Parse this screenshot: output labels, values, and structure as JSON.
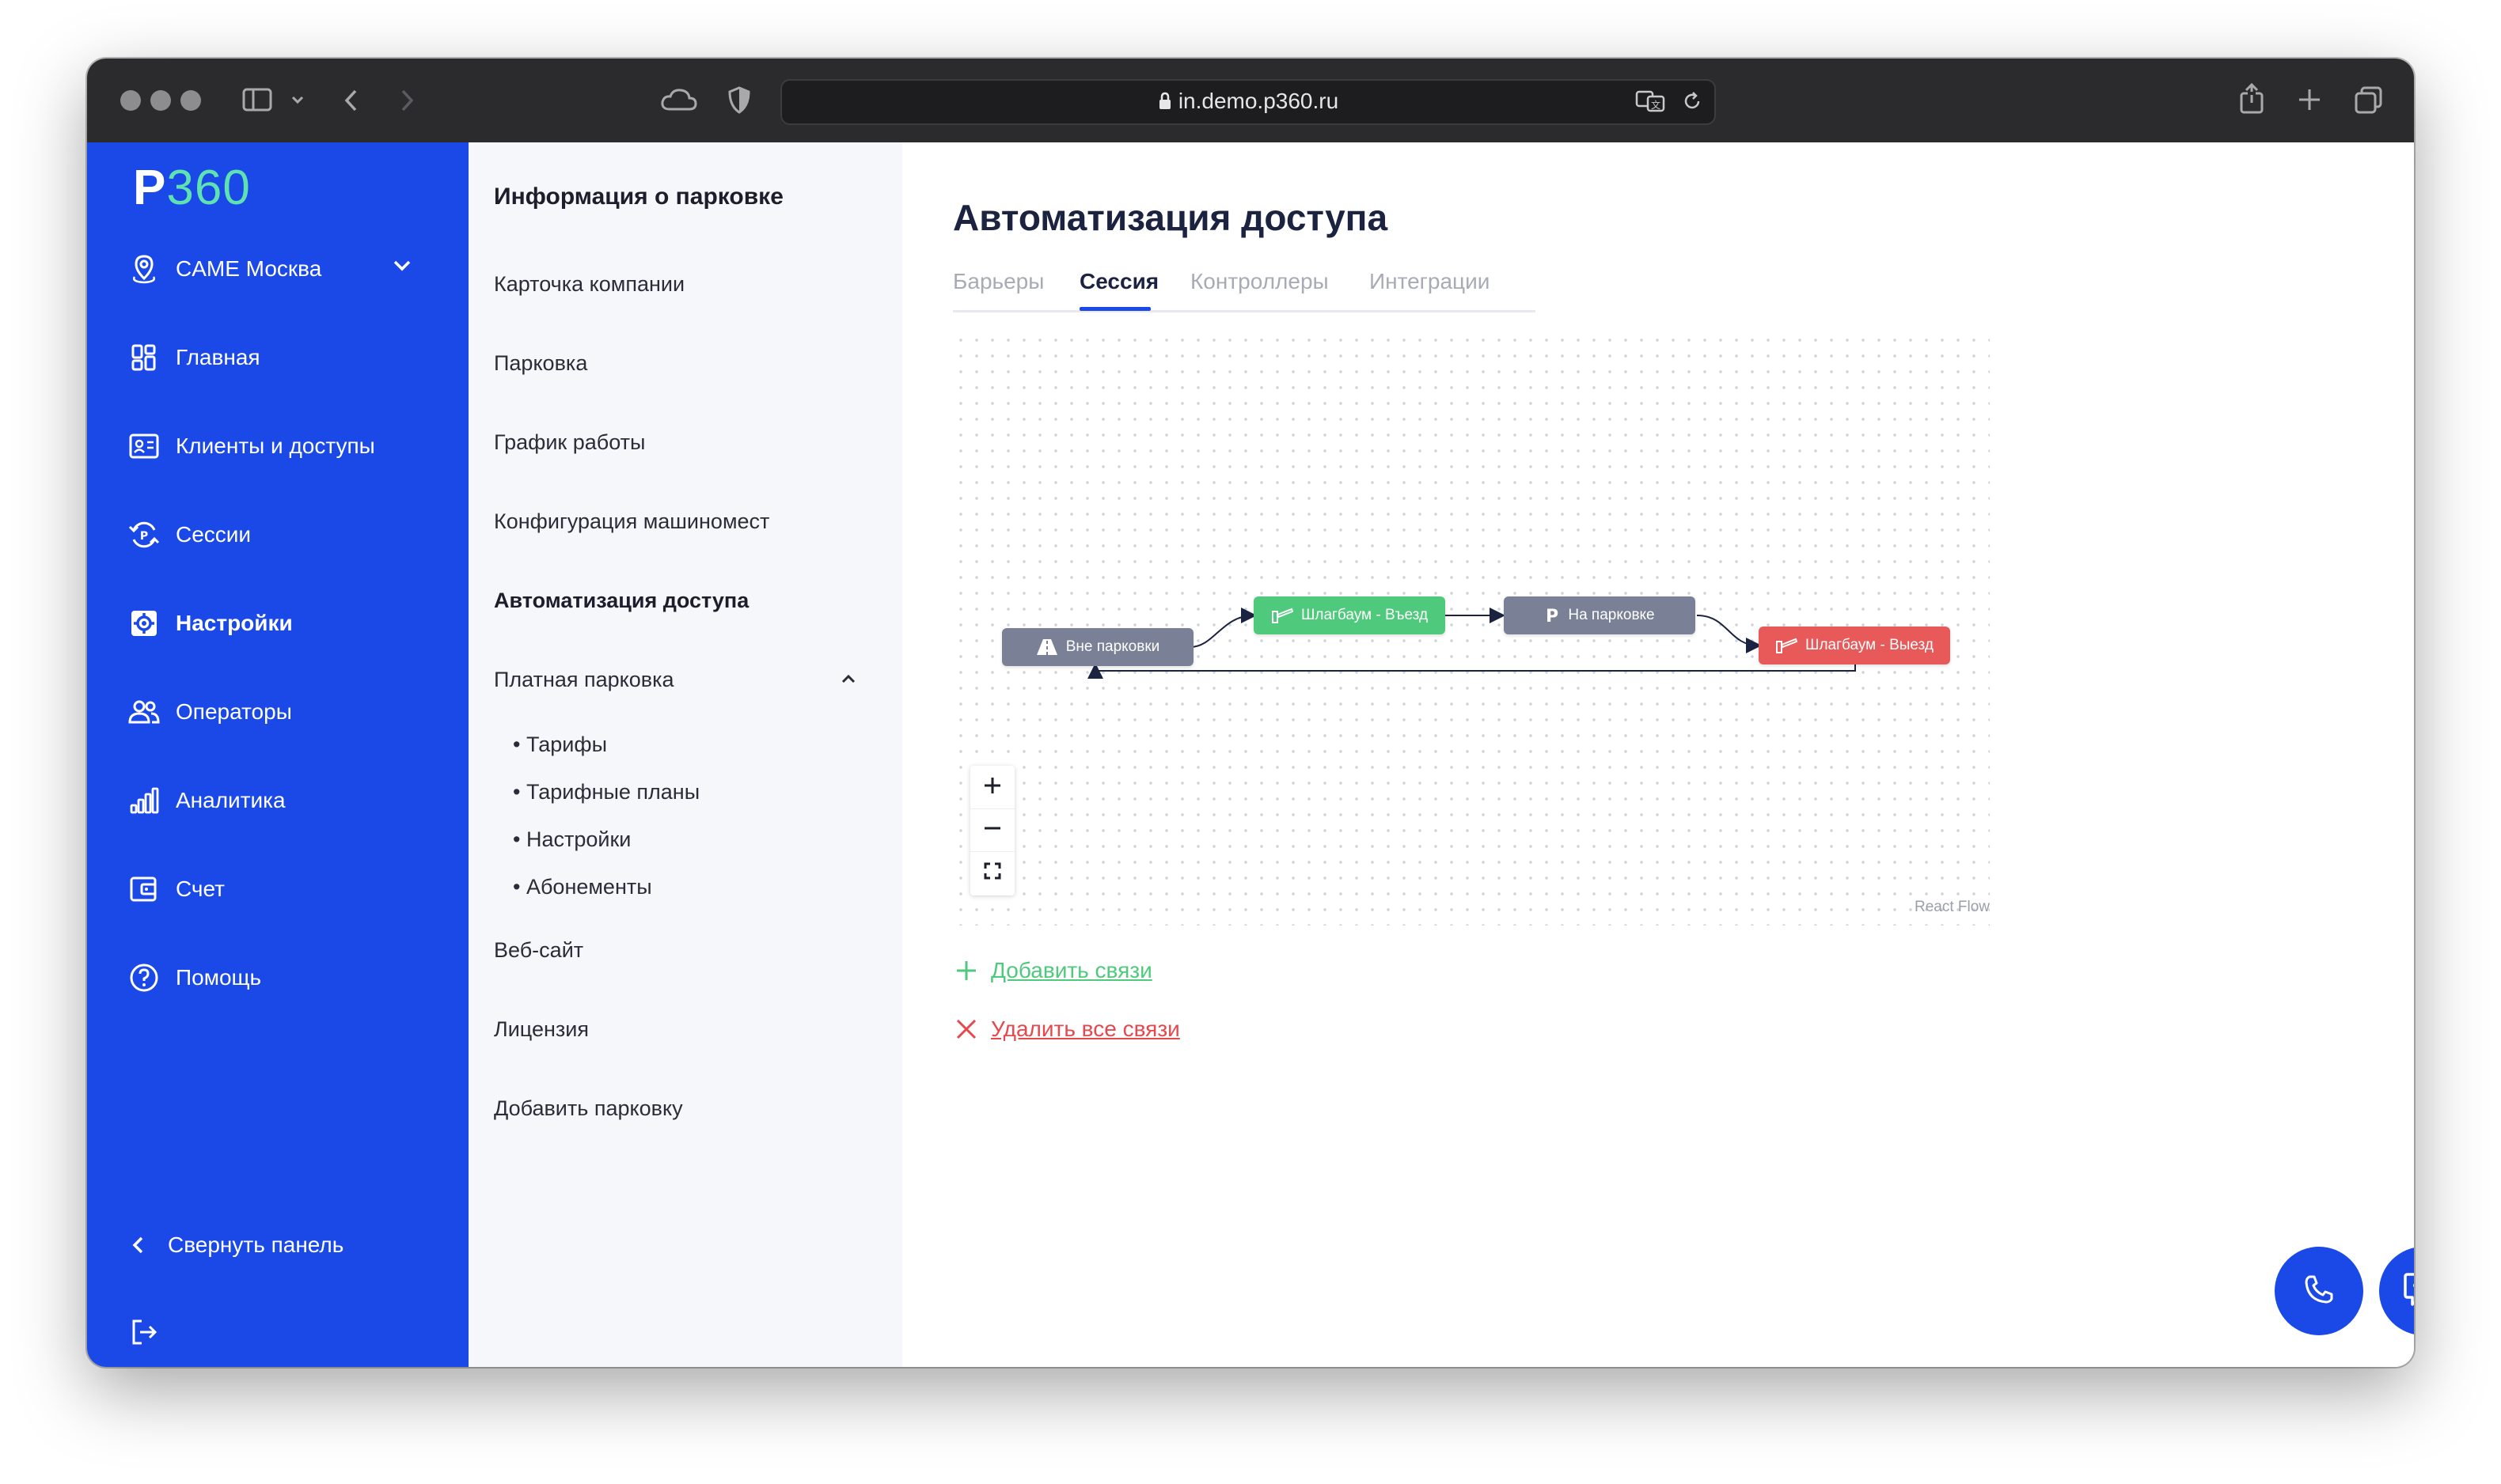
{
  "browser": {
    "url": "in.demo.p360.ru"
  },
  "sidebar": {
    "logo_p": "P",
    "logo_num": "360",
    "location": "CAME Москва",
    "items": [
      {
        "label": "Главная"
      },
      {
        "label": "Клиенты и доступы"
      },
      {
        "label": "Сессии"
      },
      {
        "label": "Настройки"
      },
      {
        "label": "Операторы"
      },
      {
        "label": "Аналитика"
      },
      {
        "label": "Счет"
      },
      {
        "label": "Помощь"
      }
    ],
    "collapse_label": "Свернуть панель",
    "colors": {
      "background": "#1b49e8",
      "logo_accent": "#5fe2b2"
    }
  },
  "submenu": {
    "title": "Информация о парковке",
    "items": [
      {
        "label": "Карточка компании"
      },
      {
        "label": "Парковка"
      },
      {
        "label": "График работы"
      },
      {
        "label": "Конфигурация машиномест"
      },
      {
        "label": "Автоматизация доступа"
      },
      {
        "label": "Платная парковка"
      }
    ],
    "paid_sub": [
      "• Тарифы",
      "• Тарифные планы",
      "• Настройки",
      "• Абонементы"
    ],
    "bottom_items": [
      {
        "label": "Веб-сайт"
      },
      {
        "label": "Лицензия"
      },
      {
        "label": "Добавить парковку"
      }
    ]
  },
  "main": {
    "title": "Автоматизация доступа",
    "tabs": [
      {
        "label": "Барьеры"
      },
      {
        "label": "Сессия"
      },
      {
        "label": "Контроллеры"
      },
      {
        "label": "Интеграции"
      }
    ],
    "active_tab": "Сессия",
    "flow": {
      "nodes": [
        {
          "label": "Вне парковки",
          "color": "#7a8196",
          "icon": "road-icon"
        },
        {
          "label": "Шлагбаум - Въезд",
          "color": "#4fca7c",
          "icon": "barrier-icon"
        },
        {
          "label": "На парковке",
          "color": "#7a8196",
          "icon": "parking-icon"
        },
        {
          "label": "Шлагбаум - Выезд",
          "color": "#e85a5a",
          "icon": "barrier-icon"
        }
      ],
      "attribution": "React Flow"
    },
    "add_link": "Добавить связи",
    "delete_link": "Удалить все связи",
    "colors": {
      "add": "#4fca7c",
      "delete": "#e5484d",
      "title": "#1c2340"
    }
  }
}
